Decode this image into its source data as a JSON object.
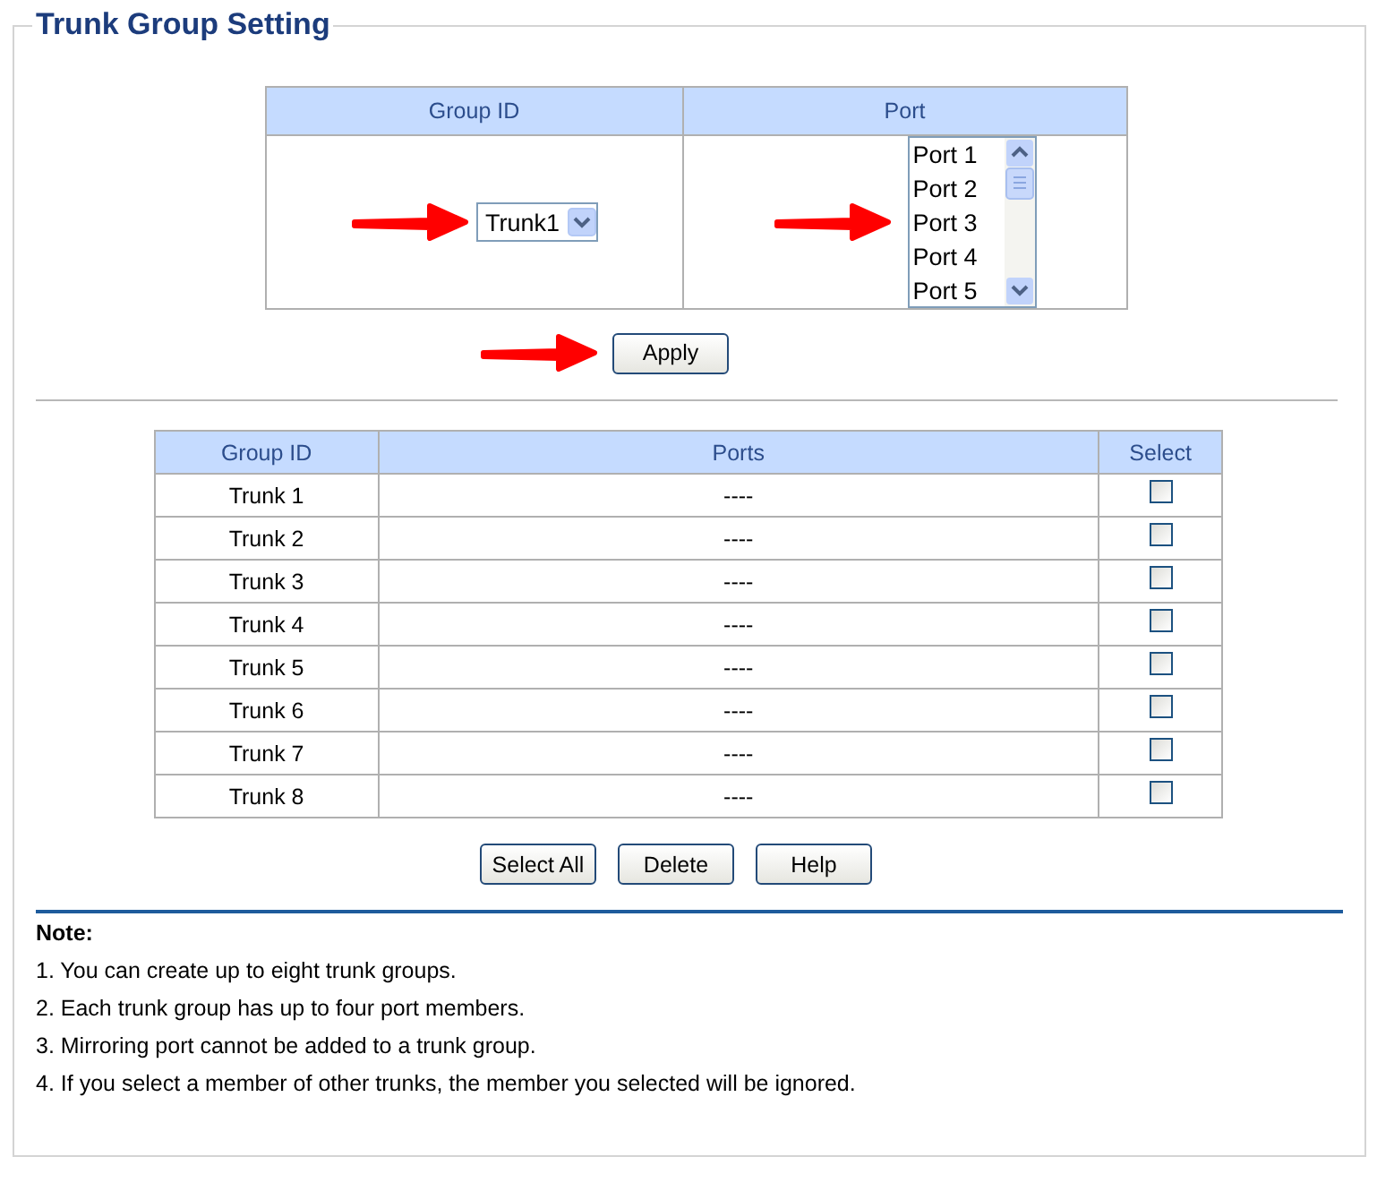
{
  "title": "Trunk Group Setting",
  "setting": {
    "columns": [
      "Group ID",
      "Port"
    ],
    "group_select": {
      "value": "Trunk1"
    },
    "ports": [
      {
        "label": "Port 1",
        "selected": false
      },
      {
        "label": "Port 2",
        "selected": false
      },
      {
        "label": "Port 3",
        "selected": false
      },
      {
        "label": "Port 4",
        "selected": false
      },
      {
        "label": "Port 5",
        "selected": false
      }
    ]
  },
  "apply": "Apply",
  "table": {
    "columns": [
      "Group ID",
      "Ports",
      "Select"
    ],
    "rows": [
      {
        "group": "Trunk 1",
        "ports": "----",
        "checked": false
      },
      {
        "group": "Trunk 2",
        "ports": "----",
        "checked": false
      },
      {
        "group": "Trunk 3",
        "ports": "----",
        "checked": false
      },
      {
        "group": "Trunk 4",
        "ports": "----",
        "checked": false
      },
      {
        "group": "Trunk 5",
        "ports": "----",
        "checked": false
      },
      {
        "group": "Trunk 6",
        "ports": "----",
        "checked": false
      },
      {
        "group": "Trunk 7",
        "ports": "----",
        "checked": false
      },
      {
        "group": "Trunk 8",
        "ports": "----",
        "checked": false
      }
    ]
  },
  "buttons": [
    "Select All",
    "Delete",
    "Help"
  ],
  "note": {
    "title": "Note:",
    "items": [
      "1. You can create up to eight trunk groups.",
      "2. Each trunk group has up to four port members.",
      "3. Mirroring port cannot be added to a trunk group.",
      "4. If you select a member of other trunks, the member you selected will be ignored."
    ]
  }
}
